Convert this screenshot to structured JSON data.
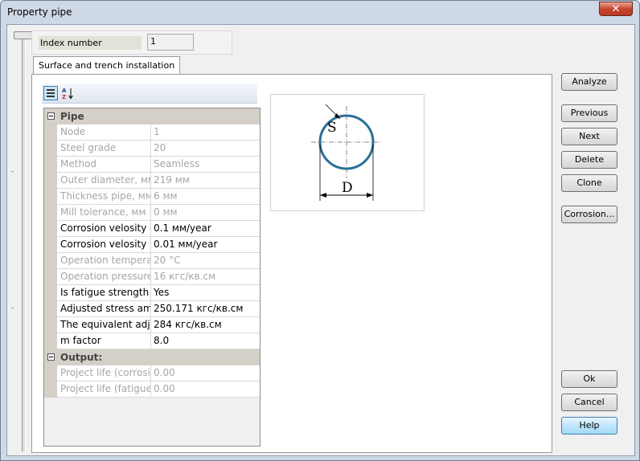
{
  "window": {
    "title": "Property pipe",
    "close_glyph": "✕"
  },
  "index": {
    "label": "Index number",
    "value": "1"
  },
  "tab": {
    "label": "Surface and trench installation"
  },
  "toolbar": {
    "categorized_icon": "categorized-icon",
    "alphabetical_icon": "sort-az-icon",
    "az_glyph": "A\nZ↓"
  },
  "property_grid": {
    "categories": [
      {
        "name": "Pipe",
        "rows": [
          {
            "name": "Node",
            "value": "1",
            "readonly": true
          },
          {
            "name": "Steel grade",
            "value": "20",
            "readonly": true
          },
          {
            "name": "Method",
            "value": "Seamless",
            "readonly": true
          },
          {
            "name": "Outer diameter, мм",
            "value": "219 мм",
            "readonly": true
          },
          {
            "name": "Thickness pipe, мм",
            "value": "6 мм",
            "readonly": true
          },
          {
            "name": "Mill tolerance, мм",
            "value": "0 мм",
            "readonly": true
          },
          {
            "name": "Corrosion velosity ou",
            "value": "0.1 мм/year",
            "readonly": false
          },
          {
            "name": "Corrosion velosity ins",
            "value": "0.01 мм/year",
            "readonly": false
          },
          {
            "name": "Operation temperatu",
            "value": "20 °C",
            "readonly": true
          },
          {
            "name": "Operation pressure,",
            "value": "16 кгс/кв.см",
            "readonly": true
          },
          {
            "name": "Is  fatigue strength :",
            "value": "Yes",
            "readonly": false
          },
          {
            "name": "Adjusted stress amp",
            "value": "250.171 кгс/кв.см",
            "readonly": false
          },
          {
            "name": "The equivalent adjus",
            "value": "284 кгс/кв.см",
            "readonly": false
          },
          {
            "name": "m factor",
            "value": " 8.0",
            "readonly": false
          }
        ]
      },
      {
        "name": "Output:",
        "rows": [
          {
            "name": "Project life (corrosion",
            "value": "  0.00",
            "readonly": true
          },
          {
            "name": "Project life (fatigue s",
            "value": "  0.00",
            "readonly": true
          }
        ]
      }
    ]
  },
  "diagram": {
    "thickness_label": "S",
    "diameter_label": "D",
    "pipe_color": "#2a6f97"
  },
  "buttons": {
    "analyze": "Analyze",
    "previous": "Previous",
    "next": "Next",
    "delete": "Delete",
    "clone": "Clone",
    "corrosion": "Corrosion...",
    "ok": "Ok",
    "cancel": "Cancel",
    "help": "Help"
  }
}
